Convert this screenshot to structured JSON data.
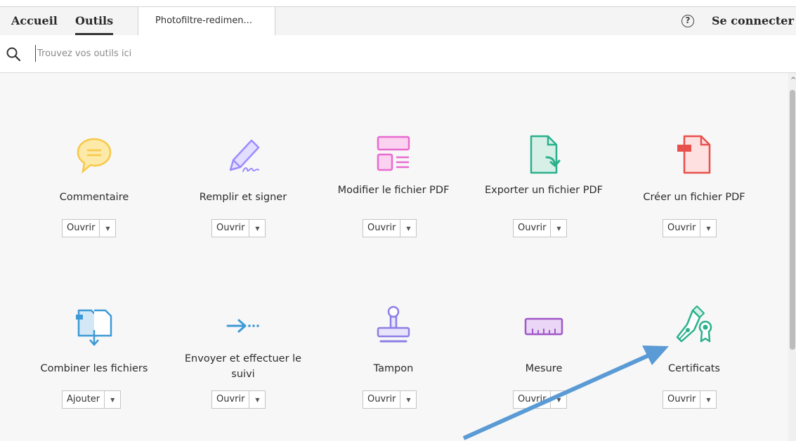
{
  "nav": {
    "home": "Accueil",
    "tools": "Outils",
    "doc_tab": "Photofiltre-redimen...",
    "help": "?",
    "signin": "Se connecter"
  },
  "search": {
    "placeholder": "Trouvez vos outils ici",
    "value": ""
  },
  "tools": [
    {
      "label": "Commentaire",
      "button": "Ouvrir",
      "icon": "comment-icon"
    },
    {
      "label": "Remplir et signer",
      "button": "Ouvrir",
      "icon": "fill-sign-icon"
    },
    {
      "label": "Modifier le fichier PDF",
      "button": "Ouvrir",
      "icon": "edit-pdf-icon"
    },
    {
      "label": "Exporter un fichier PDF",
      "button": "Ouvrir",
      "icon": "export-pdf-icon"
    },
    {
      "label": "Créer un fichier PDF",
      "button": "Ouvrir",
      "icon": "create-pdf-icon"
    },
    {
      "label": "Combiner les fichiers",
      "button": "Ajouter",
      "icon": "combine-files-icon"
    },
    {
      "label": "Envoyer et effectuer le suivi",
      "button": "Ouvrir",
      "icon": "send-track-icon"
    },
    {
      "label": "Tampon",
      "button": "Ouvrir",
      "icon": "stamp-icon"
    },
    {
      "label": "Mesure",
      "button": "Ouvrir",
      "icon": "measure-icon"
    },
    {
      "label": "Certificats",
      "button": "Ouvrir",
      "icon": "certificates-icon"
    }
  ],
  "colors": {
    "comment": "#f7c948",
    "fill_sign": "#9b8cff",
    "edit": "#e86bd0",
    "export": "#2bb08c",
    "create": "#e8504c",
    "combine": "#3d9ad6",
    "send": "#3d9ad6",
    "stamp": "#8e7fe6",
    "measure": "#a058c8",
    "certificates": "#2bb08c",
    "annotation_arrow": "#5b9bd5"
  }
}
